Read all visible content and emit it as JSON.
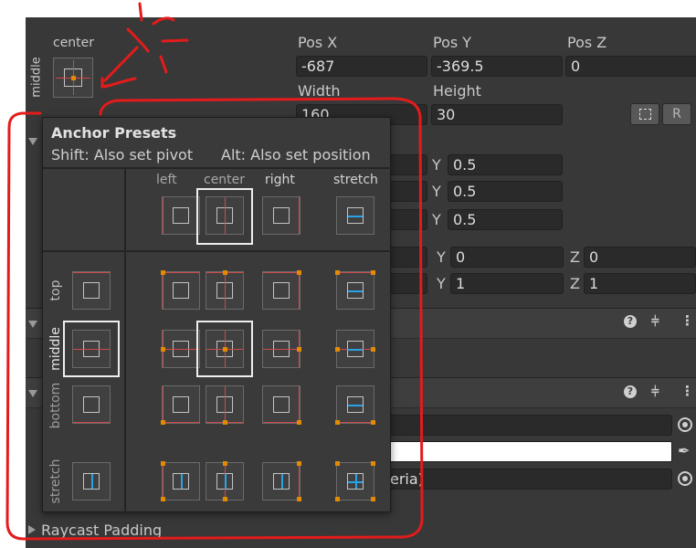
{
  "rect": {
    "anchor_label": "center",
    "pivot_label": "middle",
    "pos_x_label": "Pos X",
    "pos_y_label": "Pos Y",
    "pos_z_label": "Pos Z",
    "pos_x": "-687",
    "pos_y": "-369.5",
    "pos_z": "0",
    "width_label": "Width",
    "height_label": "Height",
    "width": "160",
    "height": "30",
    "blueprint_btn_icon": "dashed-rect-icon",
    "raw_btn_label": "R"
  },
  "hidden_rows": {
    "y_label": "Y",
    "z_label": "Z",
    "anchor_min_y": "0.5",
    "anchor_max_y": "0.5",
    "pivot_y": "0.5",
    "rotation_y": "0",
    "rotation_z": "0",
    "scale_y": "1",
    "scale_z": "1"
  },
  "image_component": {
    "material_suffix": "eria)",
    "bottom_label": "Raycast Padding"
  },
  "popup": {
    "title": "Anchor Presets",
    "shift_hint": "Shift: Also set pivot",
    "alt_hint": "Alt: Also set position",
    "columns": [
      "left",
      "center",
      "right",
      "stretch"
    ],
    "rows": [
      "top",
      "middle",
      "bottom",
      "stretch"
    ],
    "selected_column": "center",
    "selected_row": "middle"
  },
  "header_icons": [
    "help-icon",
    "sliders-icon",
    "more-icon"
  ],
  "colors": {
    "panel_bg": "#383838",
    "field_bg": "#2a2a2a",
    "anchor_red": "#d14848",
    "pivot_orange": "#e28b00",
    "stretch_blue": "#29a3e6",
    "annotation_red": "#e41b1b"
  }
}
